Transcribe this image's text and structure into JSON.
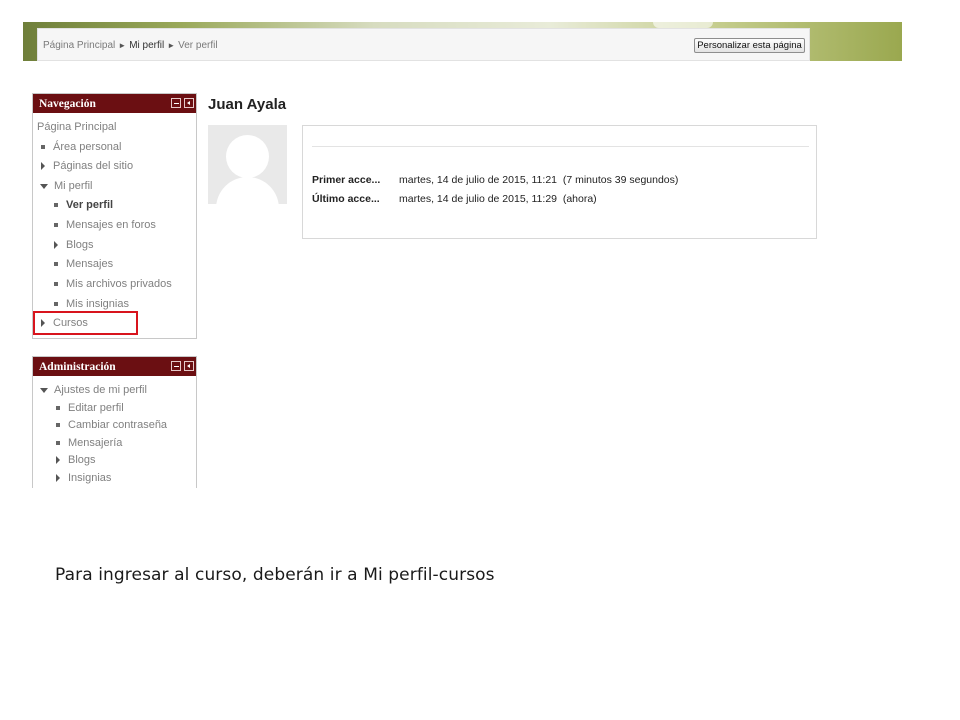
{
  "breadcrumb": {
    "items": [
      "Página Principal",
      "Mi perfil",
      "Ver perfil"
    ],
    "separator": "►"
  },
  "customize_button": "Personalizar esta página",
  "navigation": {
    "title": "Navegación",
    "items": [
      {
        "label": "Página Principal"
      },
      {
        "label": "Área personal"
      },
      {
        "label": "Páginas del sitio"
      },
      {
        "label": "Mi perfil"
      },
      {
        "label": "Ver perfil"
      },
      {
        "label": "Mensajes en foros"
      },
      {
        "label": "Blogs"
      },
      {
        "label": "Mensajes"
      },
      {
        "label": "Mis archivos privados"
      },
      {
        "label": "Mis insignias"
      },
      {
        "label": "Cursos"
      }
    ]
  },
  "administration": {
    "title": "Administración",
    "items": [
      {
        "label": "Ajustes de mi perfil"
      },
      {
        "label": "Editar perfil"
      },
      {
        "label": "Cambiar contraseña"
      },
      {
        "label": "Mensajería"
      },
      {
        "label": "Blogs"
      },
      {
        "label": "Insignias"
      }
    ]
  },
  "profile": {
    "name": "Juan Ayala",
    "rows": [
      {
        "label": "Primer acce...",
        "value": "martes, 14 de julio de 2015, 11:21  (7 minutos 39 segundos)"
      },
      {
        "label": "Último acce...",
        "value": "martes, 14 de julio de 2015, 11:29  (ahora)"
      }
    ]
  },
  "caption": "Para ingresar al curso, deberán ir a Mi perfil-cursos",
  "colors": {
    "block_header": "#6b0f12",
    "highlight": "#d8141d"
  },
  "icons": [
    "minimize-icon",
    "dock-icon",
    "bullet-icon",
    "expand-arrow-icon",
    "collapse-arrow-icon",
    "default-avatar-icon"
  ]
}
